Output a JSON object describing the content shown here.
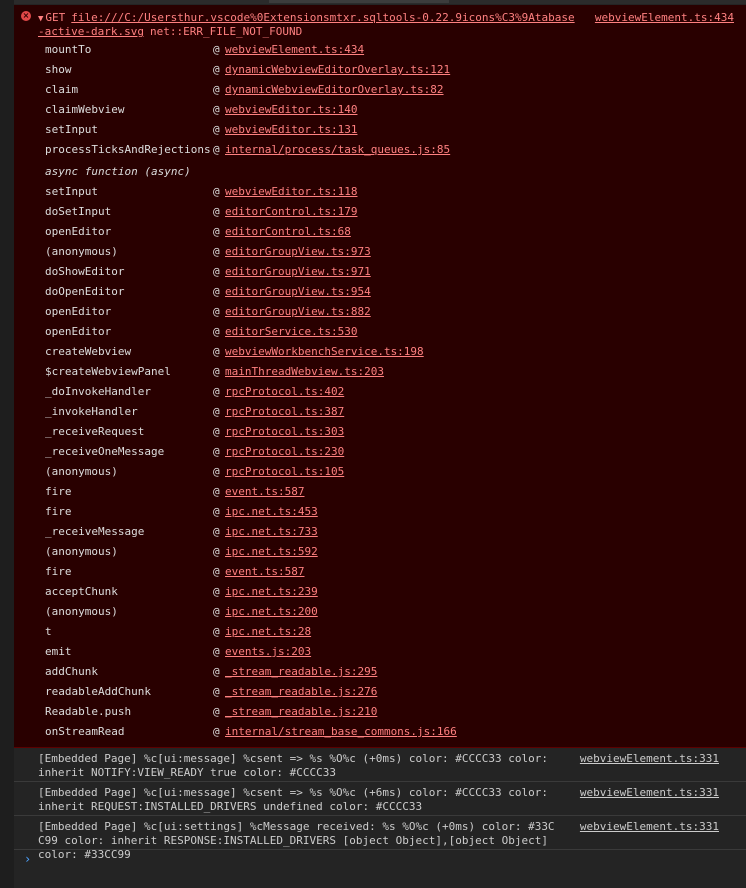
{
  "error": {
    "method": "GET",
    "url_line1": "file:///C:/Usersthur.vscode%0Extensionsmtxr.sqltools-0.22.9icons%C3%9Atabase",
    "url_line2": "-active-dark.svg",
    "error_code": "net::ERR_FILE_NOT_FOUND",
    "source": "webviewElement.ts:434",
    "at_symbol": "@",
    "async_label": "async function (async)",
    "frames_a": [
      {
        "fn": "mountTo",
        "loc": "webviewElement.ts:434"
      },
      {
        "fn": "show",
        "loc": "dynamicWebviewEditorOverlay.ts:121"
      },
      {
        "fn": "claim",
        "loc": "dynamicWebviewEditorOverlay.ts:82"
      },
      {
        "fn": "claimWebview",
        "loc": "webviewEditor.ts:140"
      },
      {
        "fn": "setInput",
        "loc": "webviewEditor.ts:131"
      },
      {
        "fn": "processTicksAndRejections",
        "loc": "internal/process/task_queues.js:85"
      }
    ],
    "frames_b": [
      {
        "fn": "setInput",
        "loc": "webviewEditor.ts:118"
      },
      {
        "fn": "doSetInput",
        "loc": "editorControl.ts:179"
      },
      {
        "fn": "openEditor",
        "loc": "editorControl.ts:68"
      },
      {
        "fn": "(anonymous)",
        "loc": "editorGroupView.ts:973"
      },
      {
        "fn": "doShowEditor",
        "loc": "editorGroupView.ts:971"
      },
      {
        "fn": "doOpenEditor",
        "loc": "editorGroupView.ts:954"
      },
      {
        "fn": "openEditor",
        "loc": "editorGroupView.ts:882"
      },
      {
        "fn": "openEditor",
        "loc": "editorService.ts:530"
      },
      {
        "fn": "createWebview",
        "loc": "webviewWorkbenchService.ts:198"
      },
      {
        "fn": "$createWebviewPanel",
        "loc": "mainThreadWebview.ts:203"
      },
      {
        "fn": "_doInvokeHandler",
        "loc": "rpcProtocol.ts:402"
      },
      {
        "fn": "_invokeHandler",
        "loc": "rpcProtocol.ts:387"
      },
      {
        "fn": "_receiveRequest",
        "loc": "rpcProtocol.ts:303"
      },
      {
        "fn": "_receiveOneMessage",
        "loc": "rpcProtocol.ts:230"
      },
      {
        "fn": "(anonymous)",
        "loc": "rpcProtocol.ts:105"
      },
      {
        "fn": "fire",
        "loc": "event.ts:587"
      },
      {
        "fn": "fire",
        "loc": "ipc.net.ts:453"
      },
      {
        "fn": "_receiveMessage",
        "loc": "ipc.net.ts:733"
      },
      {
        "fn": "(anonymous)",
        "loc": "ipc.net.ts:592"
      },
      {
        "fn": "fire",
        "loc": "event.ts:587"
      },
      {
        "fn": "acceptChunk",
        "loc": "ipc.net.ts:239"
      },
      {
        "fn": "(anonymous)",
        "loc": "ipc.net.ts:200"
      },
      {
        "fn": "t",
        "loc": "ipc.net.ts:28"
      },
      {
        "fn": "emit",
        "loc": "events.js:203"
      },
      {
        "fn": "addChunk",
        "loc": "_stream_readable.js:295"
      },
      {
        "fn": "readableAddChunk",
        "loc": "_stream_readable.js:276"
      },
      {
        "fn": "Readable.push",
        "loc": "_stream_readable.js:210"
      },
      {
        "fn": "onStreamRead",
        "loc": "internal/stream_base_commons.js:166"
      }
    ]
  },
  "logs": [
    {
      "text": "[Embedded Page] %c[ui:message] %csent => %s %O%c (+0ms) color: #CCCC33 color: inherit NOTIFY:VIEW_READY true color: #CCCC33",
      "source": "webviewElement.ts:331"
    },
    {
      "text": "[Embedded Page] %c[ui:message] %csent => %s %O%c (+6ms) color: #CCCC33 color: inherit REQUEST:INSTALLED_DRIVERS undefined color: #CCCC33",
      "source": "webviewElement.ts:331"
    },
    {
      "text": "[Embedded Page] %c[ui:settings] %cMessage received: %s %O%c (+0ms) color: #33CC99 color: inherit RESPONSE:INSTALLED_DRIVERS [object Object],[object Object] color: #33CC99",
      "source": "webviewElement.ts:331"
    }
  ],
  "prompt_symbol": "›",
  "colors": {
    "error_bg": "#290000",
    "error_text": "#ff8080",
    "console_bg": "#242424",
    "prompt": "#4da3ff"
  }
}
